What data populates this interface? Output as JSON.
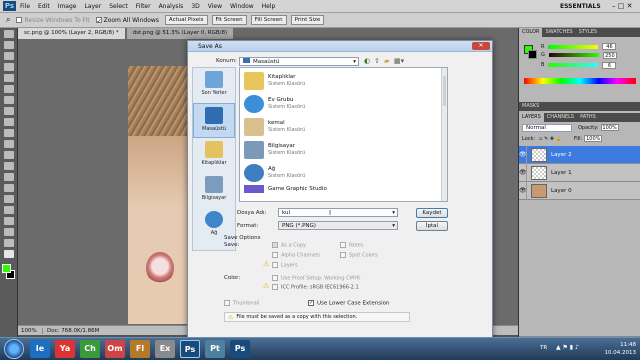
{
  "menubar": {
    "logo": "Ps",
    "items": [
      "File",
      "Edit",
      "Image",
      "Layer",
      "Select",
      "Filter",
      "Analysis",
      "3D",
      "View",
      "Window",
      "Help"
    ],
    "workspace": "ESSENTIALS"
  },
  "options": {
    "resize_label": "Resize Windows To Fit",
    "zoom_all_label": "Zoom All Windows",
    "actual_pixels": "Actual Pixels",
    "fit_screen": "Fit Screen",
    "fill_screen": "Fill Screen",
    "print_size": "Print Size"
  },
  "tabs": [
    "sc.png @ 100% (Layer 2, RGB/8) *",
    "dst.png @ 51.3% (Layer 0, RGB/8)"
  ],
  "status": {
    "zoom": "100%",
    "doc": "Doc: 768.0K/1.86M"
  },
  "dialog": {
    "title": "Save As",
    "konum_label": "Konum:",
    "konum_value": "Masaüstü",
    "places": [
      "Son Yerler",
      "Masaüstü",
      "Kitaplıklar",
      "Bilgisayar",
      "Ağ"
    ],
    "files": [
      {
        "name": "Kitaplıklar",
        "sub": "Sistem Klasörü",
        "color": "#e9c65b"
      },
      {
        "name": "Ev Grubu",
        "sub": "Sistem Klasörü",
        "color": "#3a8fd8"
      },
      {
        "name": "kemal",
        "sub": "Sistem Klasörü",
        "color": "#d9c08e"
      },
      {
        "name": "Bilgisayar",
        "sub": "Sistem Klasörü",
        "color": "#7a9ab8"
      },
      {
        "name": "Ağ",
        "sub": "Sistem Klasörü",
        "color": "#3f7fbf"
      },
      {
        "name": "Game Graphic Studio",
        "sub": "",
        "color": "#6a5acd"
      }
    ],
    "filename_label": "Dosya Adı:",
    "filename_value": "kul",
    "format_label": "Format:",
    "format_value": "PNG (*.PNG)",
    "save_btn": "Kaydet",
    "cancel_btn": "İptal",
    "save_options": "Save Options",
    "save_label": "Save:",
    "as_copy": "As a Copy",
    "notes": "Notes",
    "alpha": "Alpha Channels",
    "spot": "Spot Colors",
    "layers": "Layers",
    "color_label": "Color:",
    "proof": "Use Proof Setup:  Working CMYK",
    "icc": "ICC Profile:  sRGB IEC61966-2.1",
    "thumbnail": "Thumbnail",
    "lowercase": "Use Lower Case Extension",
    "warning": "File must be saved as a copy with this selection."
  },
  "panels": {
    "color_tabs": [
      "COLOR",
      "SWATCHES",
      "STYLES"
    ],
    "r": "46",
    "g": "250",
    "b": "6",
    "masks": "MASKS",
    "layer_tabs": [
      "LAYERS",
      "CHANNELS",
      "PATHS"
    ],
    "blend": "Normal",
    "opacity_label": "Opacity:",
    "opacity": "100%",
    "lock_label": "Lock:",
    "fill_label": "Fill:",
    "fill": "100%",
    "layers": [
      "Layer 2",
      "Layer 1",
      "Layer 0"
    ]
  },
  "taskbar": {
    "lang": "TR",
    "time": "11:48",
    "date": "10.04.2013",
    "apps": [
      "Ie",
      "Ya",
      "Ch",
      "Om",
      "Fl",
      "Ex",
      "Ps",
      "Pt",
      "Ps"
    ]
  }
}
